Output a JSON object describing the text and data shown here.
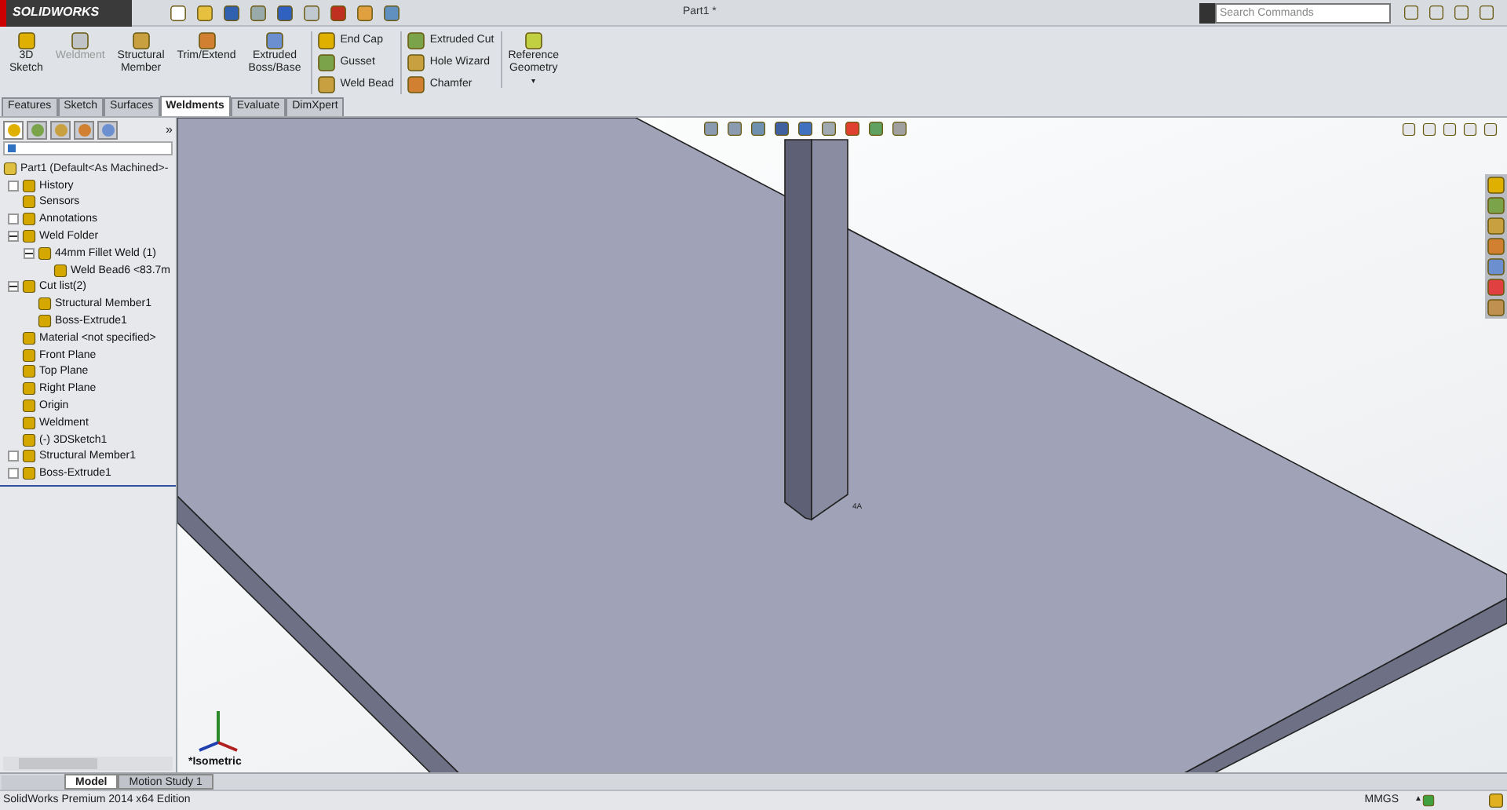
{
  "app": {
    "logo": "SOLIDWORKS",
    "document_title": "Part1 *",
    "search": {
      "placeholder": "Search Commands"
    }
  },
  "command_buttons": [
    {
      "label": "3D\nSketch",
      "disabled": false
    },
    {
      "label": "Weldment",
      "disabled": true
    },
    {
      "label": "Structural\nMember",
      "disabled": false
    },
    {
      "label": "Trim/Extend",
      "disabled": false
    },
    {
      "label": "Extruded\nBoss/Base",
      "disabled": false
    }
  ],
  "small_command_columns": [
    [
      "End Cap",
      "Gusset",
      "Weld Bead"
    ],
    [
      "Extruded Cut",
      "Hole Wizard",
      "Chamfer"
    ]
  ],
  "reference_button": {
    "label": "Reference\nGeometry",
    "caret": "▾"
  },
  "manager_more": "»",
  "tabs": [
    {
      "label": "Features",
      "selected": false
    },
    {
      "label": "Sketch",
      "selected": false
    },
    {
      "label": "Surfaces",
      "selected": false
    },
    {
      "label": "Weldments",
      "selected": true
    },
    {
      "label": "Evaluate",
      "selected": false
    },
    {
      "label": "DimXpert",
      "selected": false
    }
  ],
  "manager_tabs": [
    {
      "selected": true
    },
    {
      "selected": false
    },
    {
      "selected": false
    },
    {
      "selected": false
    },
    {
      "selected": false
    }
  ],
  "tree": {
    "root": "Part1  (Default<As Machined>-",
    "items": [
      {
        "label": "History",
        "expanded": false
      },
      {
        "label": "Sensors"
      },
      {
        "label": "Annotations",
        "expanded": false
      },
      {
        "label": "Weld Folder",
        "expanded": true,
        "children": [
          {
            "label": "44mm Fillet Weld (1)",
            "expanded": true,
            "children": [
              {
                "label": "Weld Bead6 <83.7m"
              }
            ]
          }
        ]
      },
      {
        "label": "Cut list(2)",
        "expanded": true,
        "children": [
          {
            "label": "Structural Member1"
          },
          {
            "label": "Boss-Extrude1"
          }
        ]
      },
      {
        "label": "Material <not specified>"
      },
      {
        "label": "Front Plane"
      },
      {
        "label": "Top Plane"
      },
      {
        "label": "Right Plane"
      },
      {
        "label": "Origin"
      },
      {
        "label": "Weldment"
      },
      {
        "label": "(-) 3DSketch1"
      },
      {
        "label": "Structural Member1",
        "expanded": false
      },
      {
        "label": "Boss-Extrude1",
        "expanded": false
      }
    ]
  },
  "viewport": {
    "view_label": "*Isometric",
    "weld_label": "4A"
  },
  "bottom_tabs": [
    {
      "label": "Model",
      "selected": true
    },
    {
      "label": "Motion Study 1",
      "selected": false
    }
  ],
  "status_bar": {
    "edition": "SolidWorks Premium 2014 x64 Edition",
    "units": "MMGS",
    "caret": "▲"
  }
}
